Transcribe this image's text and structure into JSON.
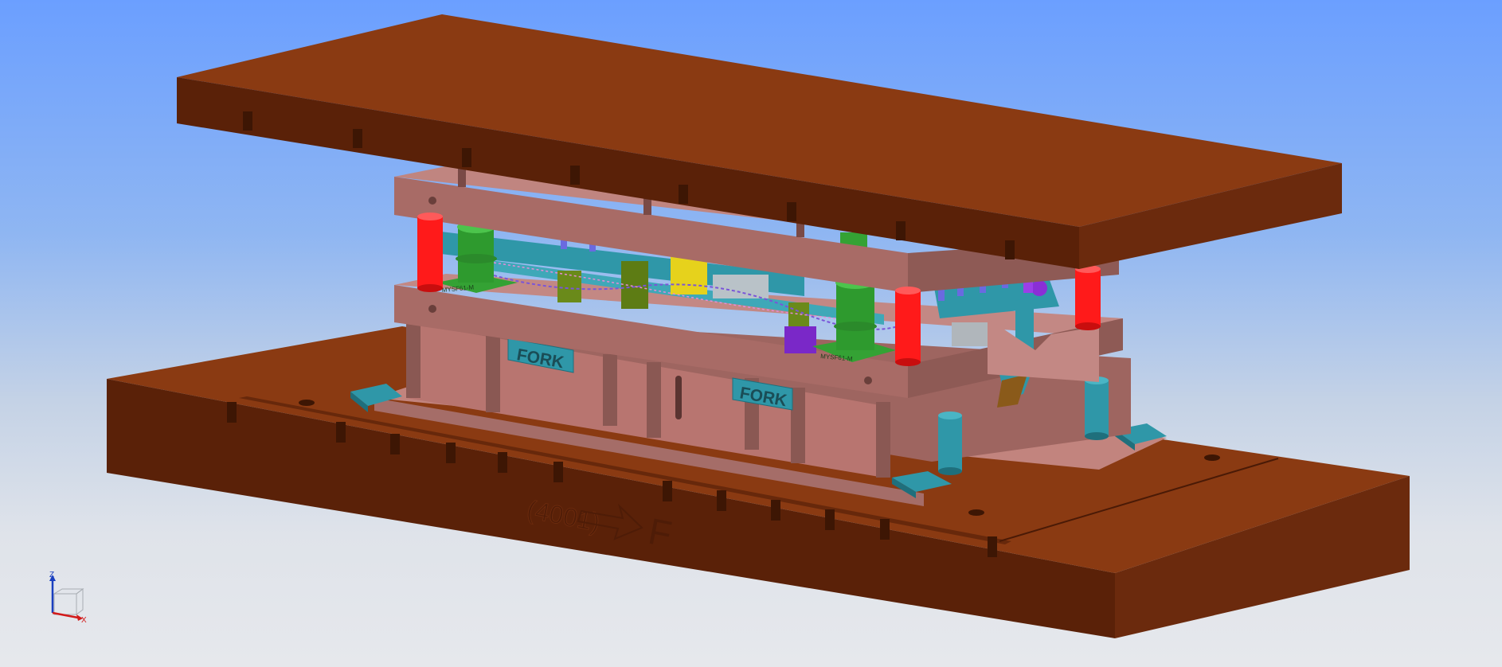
{
  "scene": {
    "fork_labels": [
      "FORK",
      "FORK"
    ],
    "part_labels": [
      "MYSF61-M",
      "MYSF61-M"
    ],
    "direction_code": "(4001)",
    "direction_letter": "F"
  },
  "triad": {
    "z_label": "Z",
    "x_label": "X"
  },
  "colors": {
    "bg_top": "#6b9fff",
    "bg_bottom": "#e6e8ec",
    "base_wood": "#7a3210",
    "die_plate": "#b77a75",
    "guide_post": "#ff1a1a",
    "bushing": "#34a234",
    "accent_teal": "#2f97a8",
    "accent_yellow": "#e6d21c",
    "accent_purple": "#7a28c8"
  }
}
